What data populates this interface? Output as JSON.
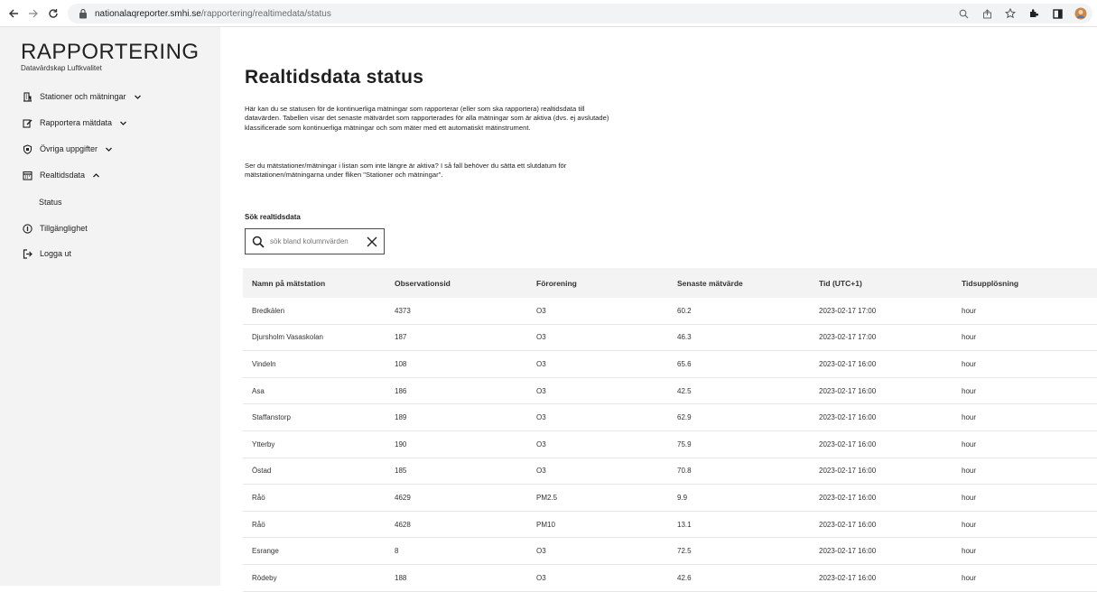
{
  "browser": {
    "url_host": "nationalaqreporter.smhi.se",
    "url_path": "/rapportering/realtimedata/status"
  },
  "sidebar": {
    "brand": "RAPPORTERING",
    "subtitle": "Datavärdskap Luftkvalitet",
    "items": [
      {
        "label": "Stationer och mätningar",
        "icon": "building-icon",
        "chevron": "down"
      },
      {
        "label": "Rapportera mätdata",
        "icon": "edit-icon",
        "chevron": "down"
      },
      {
        "label": "Övriga uppgifter",
        "icon": "shield-icon",
        "chevron": "down"
      },
      {
        "label": "Realtidsdata",
        "icon": "calendar-icon",
        "chevron": "up"
      },
      {
        "label": "Tillgänglighet",
        "icon": "info-icon"
      },
      {
        "label": "Logga ut",
        "icon": "logout-icon"
      }
    ],
    "submenu_status": "Status"
  },
  "main": {
    "title": "Realtidsdata status",
    "paragraph1": "Här kan du se statusen för de kontinuerliga mätningar som rapporterar (eller som ska rapportera) realtidsdata till datavärden. Tabellen visar det senaste mätvärdet som rapporterades för alla mätningar som är aktiva (dvs. ej avslutade) klassificerade som kontinuerliga mätningar och som mäter med ett automatiskt mätinstrument.",
    "paragraph2": "Ser du mätstationer/mätningar i listan som inte längre är aktiva? I så fall behöver du sätta ett slutdatum för mätstationen/mätningarna under fliken \"Stationer och mätningar\".",
    "search_label": "Sök realtidsdata",
    "search_placeholder": "sök bland kolumnvärden"
  },
  "table": {
    "headers": [
      "Namn på mätstation",
      "Observationsid",
      "Förorening",
      "Senaste mätvärde",
      "Tid (UTC+1)",
      "Tidsupplösning"
    ],
    "rows": [
      [
        "Bredkälen",
        "4373",
        "O3",
        "60.2",
        "2023-02-17 17:00",
        "hour"
      ],
      [
        "Djursholm Vasaskolan",
        "187",
        "O3",
        "46.3",
        "2023-02-17 17:00",
        "hour"
      ],
      [
        "Vindeln",
        "108",
        "O3",
        "65.6",
        "2023-02-17 16:00",
        "hour"
      ],
      [
        "Asa",
        "186",
        "O3",
        "42.5",
        "2023-02-17 16:00",
        "hour"
      ],
      [
        "Staffanstorp",
        "189",
        "O3",
        "62.9",
        "2023-02-17 16:00",
        "hour"
      ],
      [
        "Ytterby",
        "190",
        "O3",
        "75.9",
        "2023-02-17 16:00",
        "hour"
      ],
      [
        "Östad",
        "185",
        "O3",
        "70.8",
        "2023-02-17 16:00",
        "hour"
      ],
      [
        "Råö",
        "4629",
        "PM2.5",
        "9.9",
        "2023-02-17 16:00",
        "hour"
      ],
      [
        "Råö",
        "4628",
        "PM10",
        "13.1",
        "2023-02-17 16:00",
        "hour"
      ],
      [
        "Esrange",
        "8",
        "O3",
        "72.5",
        "2023-02-17 16:00",
        "hour"
      ],
      [
        "Rödeby",
        "188",
        "O3",
        "42.6",
        "2023-02-17 16:00",
        "hour"
      ]
    ]
  }
}
